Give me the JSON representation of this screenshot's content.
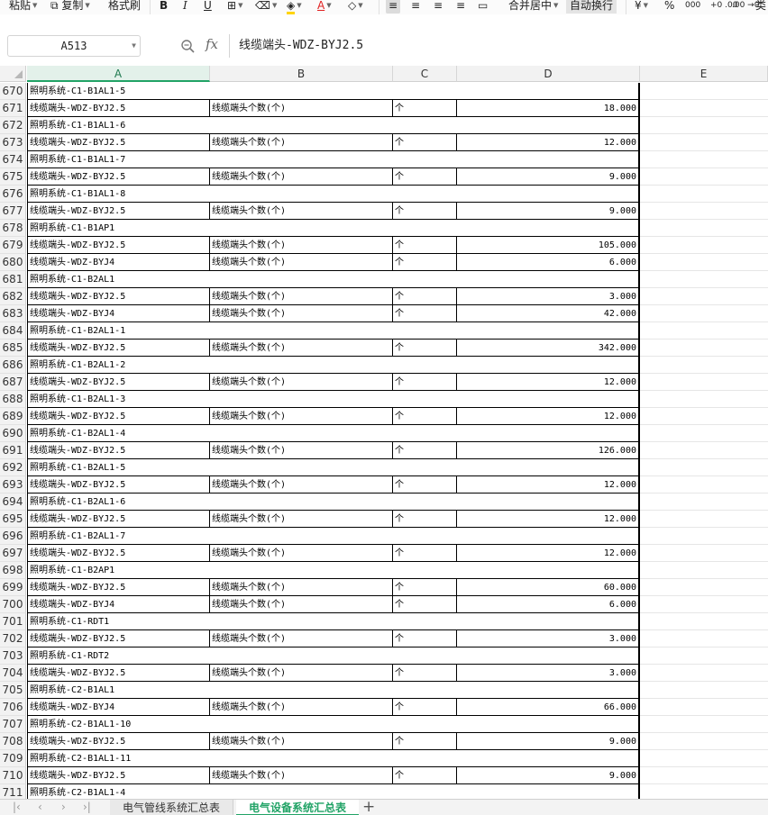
{
  "ribbon": {
    "paste": "粘贴",
    "copy": "复制",
    "format_painter": "格式刷",
    "bold": "B",
    "italic": "I",
    "underline": "U",
    "merge_center": "合并居中",
    "wrap_text": "自动换行",
    "currency": "¥",
    "percent": "%",
    "thousands": "000",
    "inc_decimal": "+0 .00",
    "dec_decimal": ".00 →0",
    "type": "类"
  },
  "formula_bar": {
    "name_box": "A513",
    "fx": "fx",
    "content": "线缆端头-WDZ-BYJ2.5"
  },
  "columns": [
    "A",
    "B",
    "C",
    "D",
    "E"
  ],
  "rows": [
    {
      "n": "670",
      "kind": "h",
      "a": "照明系统-C1-B1AL1-5"
    },
    {
      "n": "671",
      "kind": "d",
      "a": "线缆端头-WDZ-BYJ2.5",
      "b": "线缆端头个数(个)",
      "c": "个",
      "d": "18.000"
    },
    {
      "n": "672",
      "kind": "h",
      "a": "照明系统-C1-B1AL1-6"
    },
    {
      "n": "673",
      "kind": "d",
      "a": "线缆端头-WDZ-BYJ2.5",
      "b": "线缆端头个数(个)",
      "c": "个",
      "d": "12.000"
    },
    {
      "n": "674",
      "kind": "h",
      "a": "照明系统-C1-B1AL1-7"
    },
    {
      "n": "675",
      "kind": "d",
      "a": "线缆端头-WDZ-BYJ2.5",
      "b": "线缆端头个数(个)",
      "c": "个",
      "d": "9.000"
    },
    {
      "n": "676",
      "kind": "h",
      "a": "照明系统-C1-B1AL1-8"
    },
    {
      "n": "677",
      "kind": "d",
      "a": "线缆端头-WDZ-BYJ2.5",
      "b": "线缆端头个数(个)",
      "c": "个",
      "d": "9.000"
    },
    {
      "n": "678",
      "kind": "h",
      "a": "照明系统-C1-B1AP1"
    },
    {
      "n": "679",
      "kind": "d",
      "a": "线缆端头-WDZ-BYJ2.5",
      "b": "线缆端头个数(个)",
      "c": "个",
      "d": "105.000"
    },
    {
      "n": "680",
      "kind": "d",
      "a": "线缆端头-WDZ-BYJ4",
      "b": "线缆端头个数(个)",
      "c": "个",
      "d": "6.000"
    },
    {
      "n": "681",
      "kind": "h",
      "a": "照明系统-C1-B2AL1"
    },
    {
      "n": "682",
      "kind": "d",
      "a": "线缆端头-WDZ-BYJ2.5",
      "b": "线缆端头个数(个)",
      "c": "个",
      "d": "3.000"
    },
    {
      "n": "683",
      "kind": "d",
      "a": "线缆端头-WDZ-BYJ4",
      "b": "线缆端头个数(个)",
      "c": "个",
      "d": "42.000"
    },
    {
      "n": "684",
      "kind": "h",
      "a": "照明系统-C1-B2AL1-1"
    },
    {
      "n": "685",
      "kind": "d",
      "a": "线缆端头-WDZ-BYJ2.5",
      "b": "线缆端头个数(个)",
      "c": "个",
      "d": "342.000"
    },
    {
      "n": "686",
      "kind": "h",
      "a": "照明系统-C1-B2AL1-2"
    },
    {
      "n": "687",
      "kind": "d",
      "a": "线缆端头-WDZ-BYJ2.5",
      "b": "线缆端头个数(个)",
      "c": "个",
      "d": "12.000"
    },
    {
      "n": "688",
      "kind": "h",
      "a": "照明系统-C1-B2AL1-3"
    },
    {
      "n": "689",
      "kind": "d",
      "a": "线缆端头-WDZ-BYJ2.5",
      "b": "线缆端头个数(个)",
      "c": "个",
      "d": "12.000"
    },
    {
      "n": "690",
      "kind": "h",
      "a": "照明系统-C1-B2AL1-4"
    },
    {
      "n": "691",
      "kind": "d",
      "a": "线缆端头-WDZ-BYJ2.5",
      "b": "线缆端头个数(个)",
      "c": "个",
      "d": "126.000"
    },
    {
      "n": "692",
      "kind": "h",
      "a": "照明系统-C1-B2AL1-5"
    },
    {
      "n": "693",
      "kind": "d",
      "a": "线缆端头-WDZ-BYJ2.5",
      "b": "线缆端头个数(个)",
      "c": "个",
      "d": "12.000"
    },
    {
      "n": "694",
      "kind": "h",
      "a": "照明系统-C1-B2AL1-6"
    },
    {
      "n": "695",
      "kind": "d",
      "a": "线缆端头-WDZ-BYJ2.5",
      "b": "线缆端头个数(个)",
      "c": "个",
      "d": "12.000"
    },
    {
      "n": "696",
      "kind": "h",
      "a": "照明系统-C1-B2AL1-7"
    },
    {
      "n": "697",
      "kind": "d",
      "a": "线缆端头-WDZ-BYJ2.5",
      "b": "线缆端头个数(个)",
      "c": "个",
      "d": "12.000"
    },
    {
      "n": "698",
      "kind": "h",
      "a": "照明系统-C1-B2AP1"
    },
    {
      "n": "699",
      "kind": "d",
      "a": "线缆端头-WDZ-BYJ2.5",
      "b": "线缆端头个数(个)",
      "c": "个",
      "d": "60.000"
    },
    {
      "n": "700",
      "kind": "d",
      "a": "线缆端头-WDZ-BYJ4",
      "b": "线缆端头个数(个)",
      "c": "个",
      "d": "6.000"
    },
    {
      "n": "701",
      "kind": "h",
      "a": "照明系统-C1-RDT1"
    },
    {
      "n": "702",
      "kind": "d",
      "a": "线缆端头-WDZ-BYJ2.5",
      "b": "线缆端头个数(个)",
      "c": "个",
      "d": "3.000"
    },
    {
      "n": "703",
      "kind": "h",
      "a": "照明系统-C1-RDT2"
    },
    {
      "n": "704",
      "kind": "d",
      "a": "线缆端头-WDZ-BYJ2.5",
      "b": "线缆端头个数(个)",
      "c": "个",
      "d": "3.000"
    },
    {
      "n": "705",
      "kind": "h",
      "a": "照明系统-C2-B1AL1"
    },
    {
      "n": "706",
      "kind": "d",
      "a": "线缆端头-WDZ-BYJ4",
      "b": "线缆端头个数(个)",
      "c": "个",
      "d": "66.000"
    },
    {
      "n": "707",
      "kind": "h",
      "a": "照明系统-C2-B1AL1-10"
    },
    {
      "n": "708",
      "kind": "d",
      "a": "线缆端头-WDZ-BYJ2.5",
      "b": "线缆端头个数(个)",
      "c": "个",
      "d": "9.000"
    },
    {
      "n": "709",
      "kind": "h",
      "a": "照明系统-C2-B1AL1-11"
    },
    {
      "n": "710",
      "kind": "d",
      "a": "线缆端头-WDZ-BYJ2.5",
      "b": "线缆端头个数(个)",
      "c": "个",
      "d": "9.000"
    },
    {
      "n": "711",
      "kind": "h",
      "a": "照明系统-C2-B1AL1-4"
    }
  ],
  "sheets": {
    "tab1": "电气管线系统汇总表",
    "tab2": "电气设备系统汇总表",
    "add": "+"
  },
  "colors": {
    "accent": "#21a366",
    "grid": "#000000"
  }
}
